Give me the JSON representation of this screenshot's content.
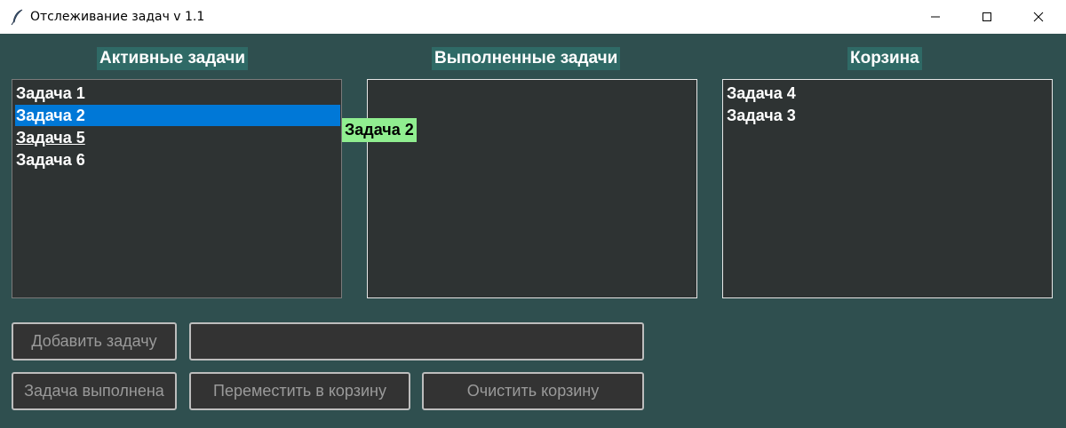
{
  "window": {
    "title": "Отслеживание задач v 1.1",
    "icon": "feather-icon",
    "controls": [
      "minimize-icon",
      "maximize-icon",
      "close-icon"
    ]
  },
  "columns": {
    "active": {
      "title": "Активные задачи",
      "items": [
        "Задача 1",
        "Задача 2",
        "Задача 5",
        "Задача 6"
      ],
      "selected_index": 1,
      "underlined_index": 2
    },
    "done": {
      "title": "Выполненные задачи",
      "items": []
    },
    "trash": {
      "title": "Корзина",
      "items": [
        "Задача 4",
        "Задача 3"
      ]
    }
  },
  "drag_label": "Задача 2",
  "controls": {
    "add_button": "Добавить задачу",
    "task_input_value": "",
    "done_button": "Задача выполнена",
    "move_to_trash_button": "Переместить в корзину",
    "clear_trash_button": "Очистить корзину"
  },
  "colors": {
    "background": "#2f4f4f",
    "header_bg": "#2f6a66",
    "listbox_bg": "#2e3333",
    "selection": "#0078d7",
    "drag_label_bg": "#90ee90",
    "button_bg": "#333333"
  }
}
